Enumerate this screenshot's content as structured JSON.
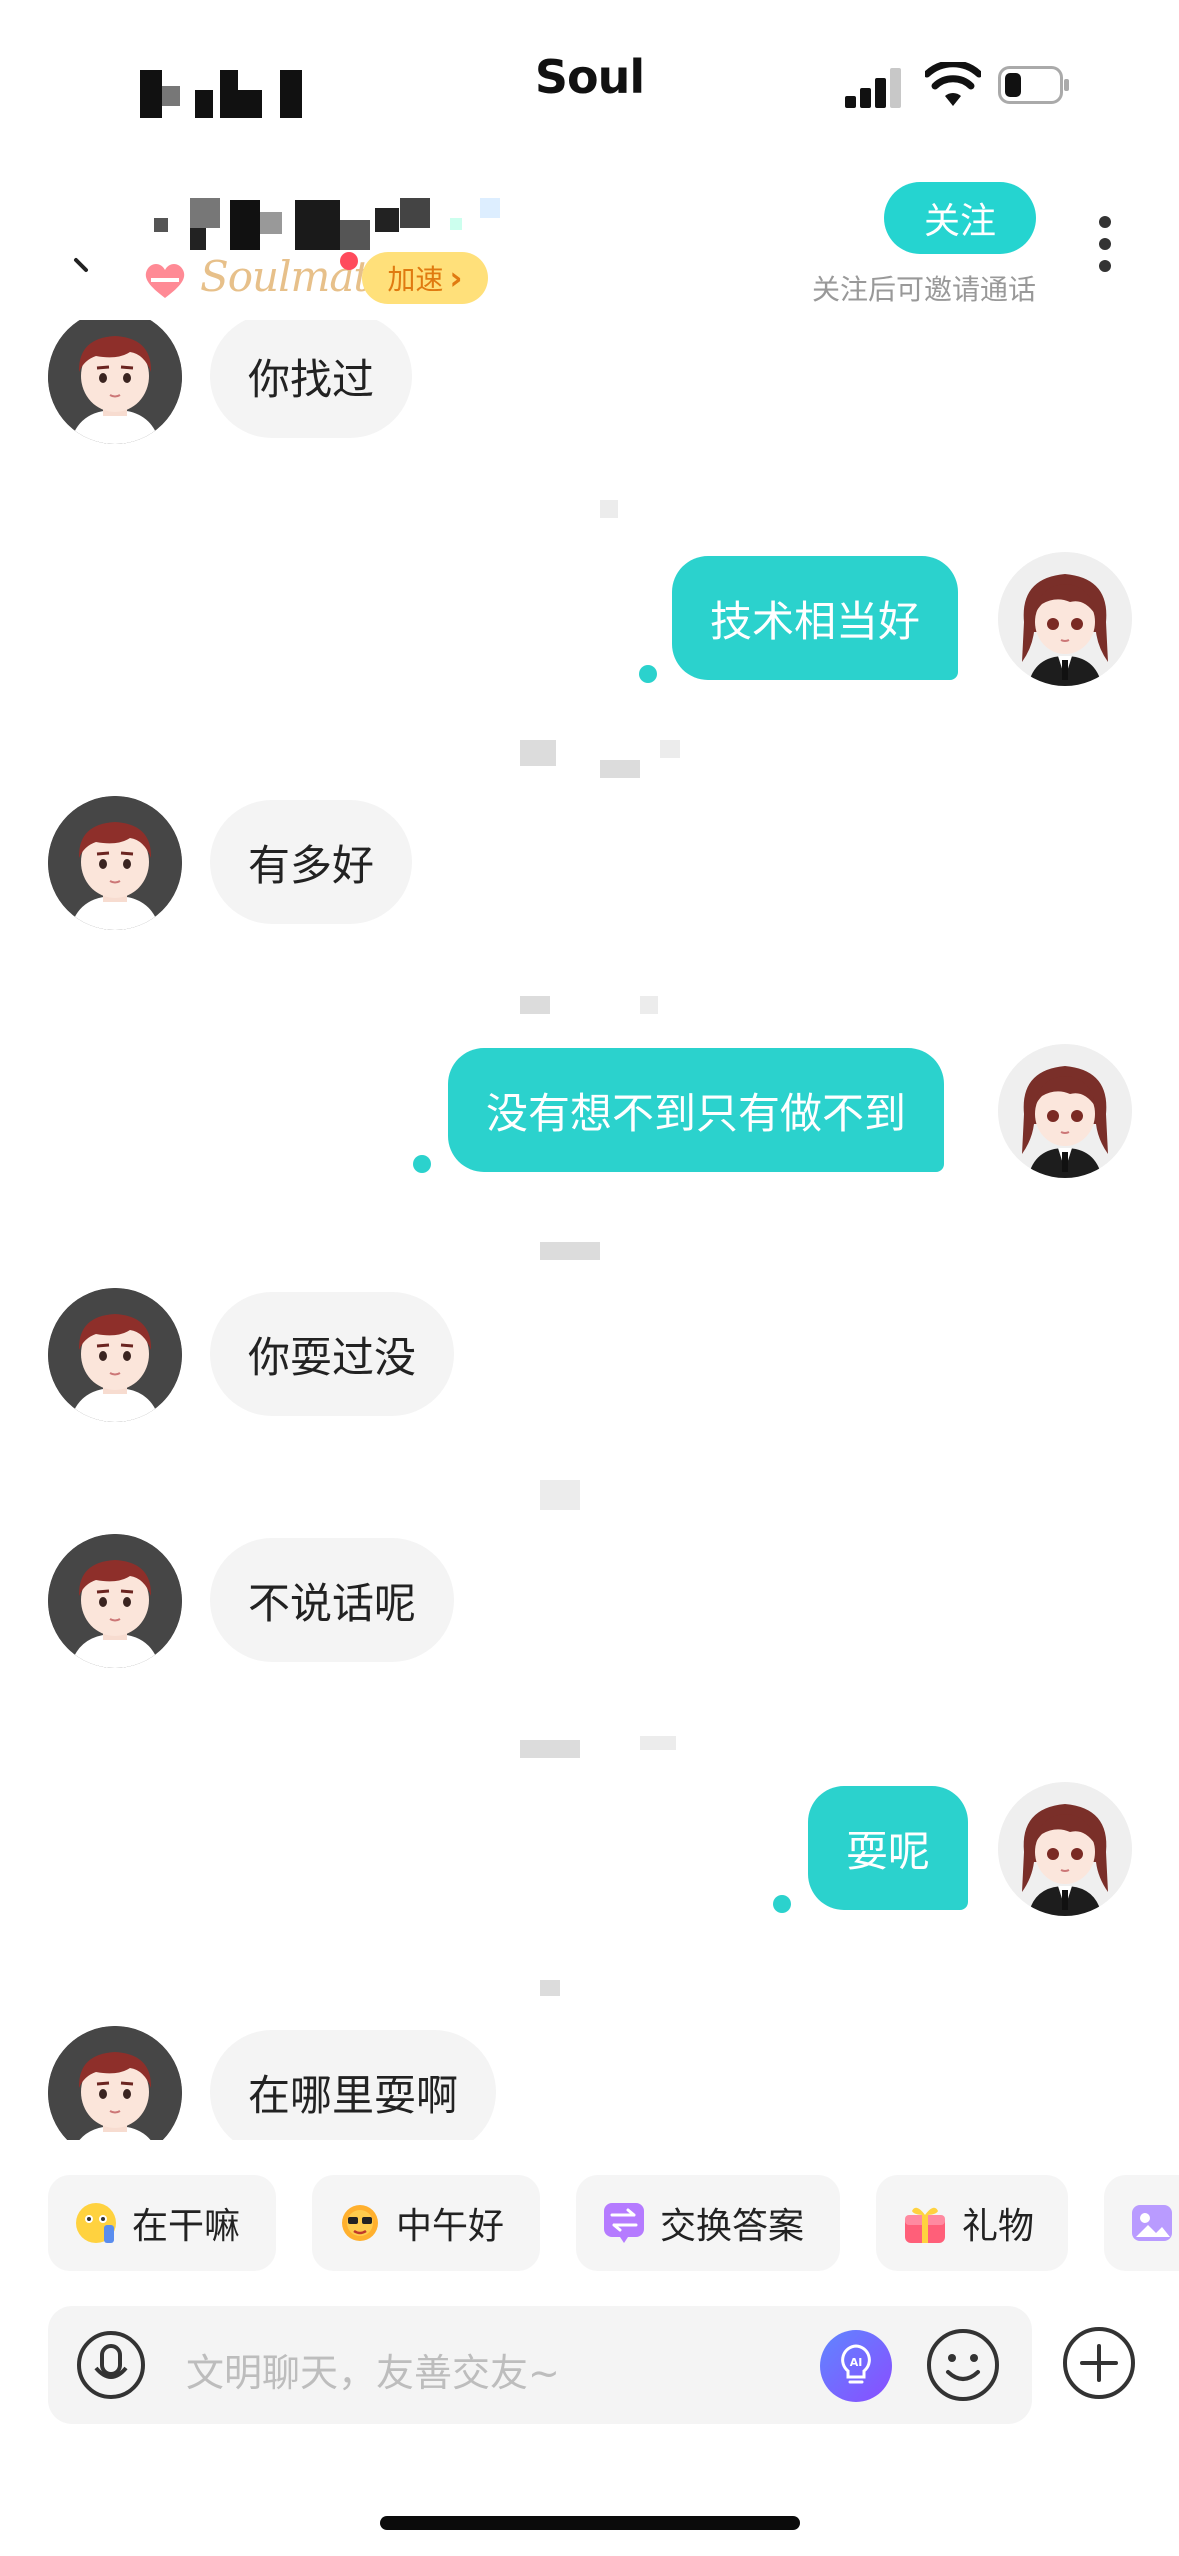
{
  "status_bar": {
    "carrier": "Soul"
  },
  "header": {
    "soulmate_label": "Soulmate",
    "speedup_label": "加速",
    "speedup_chevron": "›",
    "follow_label": "关注",
    "follow_hint": "关注后可邀请通话",
    "accent_color": "#25d4d0"
  },
  "messages": [
    {
      "side": "in",
      "text": "你找过"
    },
    {
      "side": "out",
      "text": "技术相当好"
    },
    {
      "side": "in",
      "text": "有多好"
    },
    {
      "side": "out",
      "text": "没有想不到只有做不到"
    },
    {
      "side": "in",
      "text": "你耍过没"
    },
    {
      "side": "in",
      "text": "不说话呢"
    },
    {
      "side": "out",
      "text": "耍呢"
    },
    {
      "side": "in",
      "text": "在哪里耍啊"
    }
  ],
  "quick_replies": [
    {
      "icon": "thinking-emoji-icon",
      "label": "在干嘛"
    },
    {
      "icon": "sun-sunglasses-icon",
      "label": "中午好"
    },
    {
      "icon": "swap-icon",
      "label": "交换答案"
    },
    {
      "icon": "gift-icon",
      "label": "礼物"
    }
  ],
  "input": {
    "placeholder": "文明聊天，友善交友~",
    "icons": [
      "mic-icon",
      "ai-icon",
      "emoji-icon",
      "plus-icon"
    ]
  }
}
